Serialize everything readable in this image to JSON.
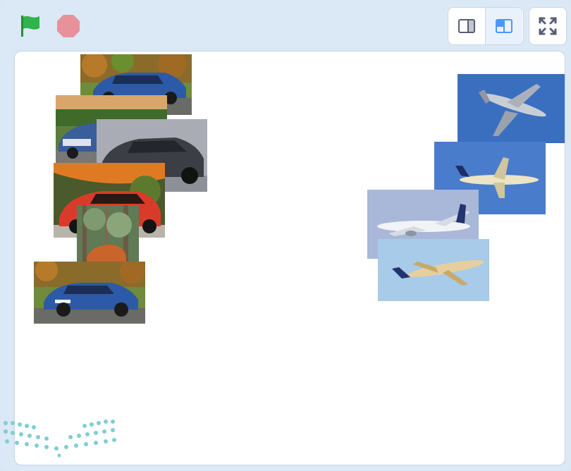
{
  "toolbar": {
    "green_flag_color": "#2fb34a",
    "stop_color": "#e8919a",
    "small_stage_icon": "small-stage-icon",
    "normal_stage_icon": "normal-stage-icon",
    "fullscreen_icon": "fullscreen-icon",
    "accent": "#4c97ff"
  },
  "stage": {
    "background": "#ffffff",
    "car_sprites": [
      {
        "name": "car-blue-bmw-1",
        "car_color": "#2c5aa8",
        "scene": "autumn-trees"
      },
      {
        "name": "car-blue-audi",
        "car_color": "#3a5d9c",
        "scene": "green-trees"
      },
      {
        "name": "car-dark-grey-suv",
        "car_color": "#3b3e44",
        "scene": "grey-background"
      },
      {
        "name": "car-red-coupe",
        "car_color": "#d93b2b",
        "scene": "sunset-trees"
      },
      {
        "name": "car-orange-forest",
        "car_color": "#c9652b",
        "scene": "forest"
      },
      {
        "name": "car-blue-bmw-2",
        "car_color": "#2c5aa8",
        "scene": "autumn-trees"
      }
    ],
    "plane_sprites": [
      {
        "name": "plane-military-transport",
        "sky": "#3a6fc0"
      },
      {
        "name": "plane-airliner-1",
        "sky": "#4a7ccc"
      },
      {
        "name": "plane-airliner-2",
        "sky": "#a9b8d8"
      },
      {
        "name": "plane-airliner-3",
        "sky": "#a7cbe8"
      }
    ]
  },
  "watermark": {
    "icon": "dotted-logo-watermark",
    "color": "#7fcfd0"
  }
}
